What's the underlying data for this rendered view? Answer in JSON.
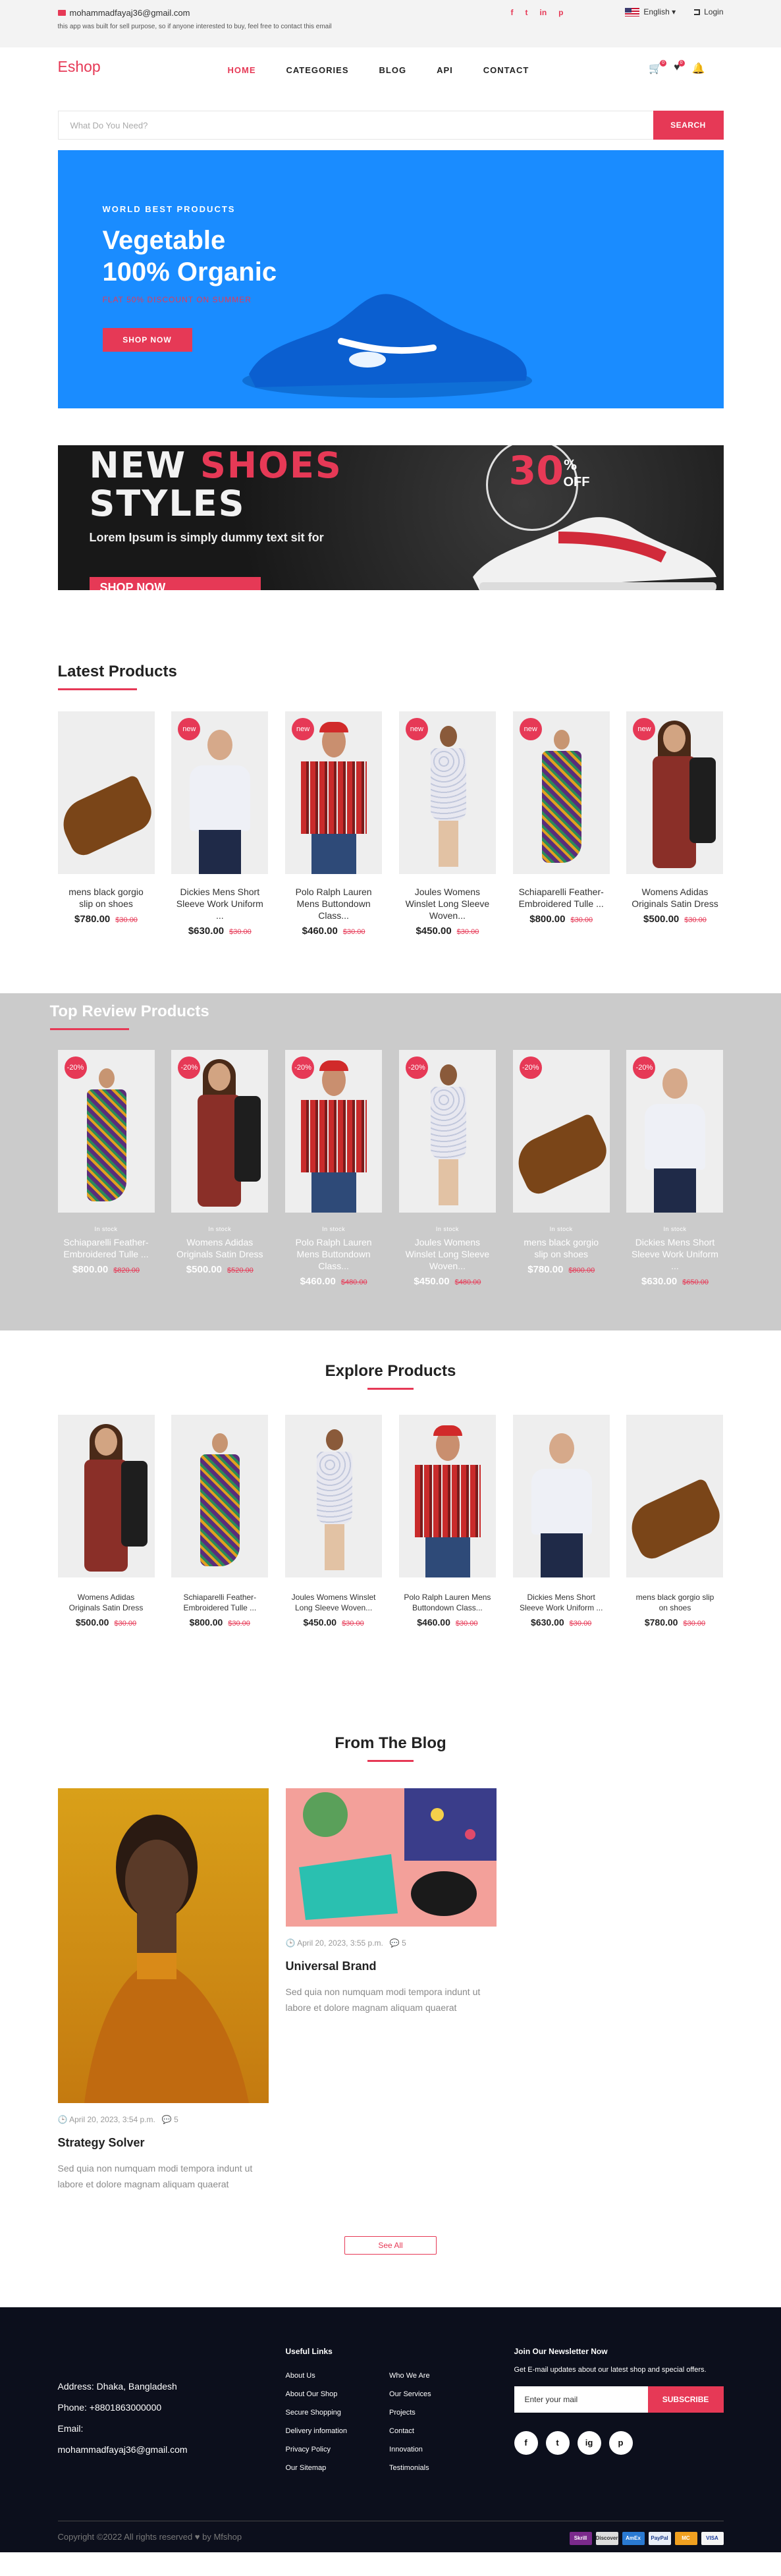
{
  "topbar": {
    "email": "mohammadfayaj36@gmail.com",
    "note": "this app was built for sell purpose, so if anyone interested to buy, feel free to contact this email",
    "social": [
      "f",
      "t",
      "in",
      "p"
    ],
    "language": "English",
    "login": "Login"
  },
  "header": {
    "logo": "Eshop",
    "nav": [
      "HOME",
      "CATEGORIES",
      "BLOG",
      "API",
      "CONTACT"
    ],
    "cart_count": "0",
    "wish_count": "0"
  },
  "search": {
    "placeholder": "What Do You Need?",
    "button": "SEARCH"
  },
  "hero": {
    "overline": "WORLD BEST PRODUCTS",
    "title_line1": "Vegetable",
    "title_line2": "100% Organic",
    "subtitle": "FLAT 50% DISCOUNT ON SUMMER",
    "button": "SHOP NOW"
  },
  "banner": {
    "line1_a": "NEW",
    "line1_b": "SHOES",
    "line2": "STYLES",
    "percent": "30",
    "percent_sign": "%",
    "off": "OFF",
    "text": "Lorem Ipsum is simply dummy text sit for",
    "button": "SHOP NOW"
  },
  "latest": {
    "title": "Latest Products",
    "products": [
      {
        "name": "mens black gorgio slip on shoes",
        "price": "$780.00",
        "old": "$30.00",
        "badge": "",
        "art": "shoe"
      },
      {
        "name": "Dickies Mens Short Sleeve Work Uniform ...",
        "price": "$630.00",
        "old": "$30.00",
        "badge": "new",
        "art": "man"
      },
      {
        "name": "Polo Ralph Lauren Mens Buttondown Class...",
        "price": "$460.00",
        "old": "$30.00",
        "badge": "new",
        "art": "polo"
      },
      {
        "name": "Joules Womens Winslet Long Sleeve Woven...",
        "price": "$450.00",
        "old": "$30.00",
        "badge": "new",
        "art": "dress"
      },
      {
        "name": "Schiaparelli Feather-Embroidered Tulle ...",
        "price": "$800.00",
        "old": "$30.00",
        "badge": "new",
        "art": "schia"
      },
      {
        "name": "Womens Adidas Originals Satin Dress",
        "price": "$500.00",
        "old": "$30.00",
        "badge": "new",
        "art": "womens"
      }
    ]
  },
  "top_review": {
    "title": "Top Review Products",
    "products": [
      {
        "name": "Schiaparelli Feather-Embroidered Tulle ...",
        "price": "$800.00",
        "old": "$820.00",
        "badge": "-20%",
        "stock": "In stock",
        "art": "schia"
      },
      {
        "name": "Womens Adidas Originals Satin Dress",
        "price": "$500.00",
        "old": "$520.00",
        "badge": "-20%",
        "stock": "In stock",
        "art": "womens"
      },
      {
        "name": "Polo Ralph Lauren Mens Buttondown Class...",
        "price": "$460.00",
        "old": "$480.00",
        "badge": "-20%",
        "stock": "In stock",
        "art": "polo"
      },
      {
        "name": "Joules Womens Winslet Long Sleeve Woven...",
        "price": "$450.00",
        "old": "$480.00",
        "badge": "-20%",
        "stock": "In stock",
        "art": "dress"
      },
      {
        "name": "mens black gorgio slip on shoes",
        "price": "$780.00",
        "old": "$800.00",
        "badge": "-20%",
        "stock": "In stock",
        "art": "shoe"
      },
      {
        "name": "Dickies Mens Short Sleeve Work Uniform ...",
        "price": "$630.00",
        "old": "$650.00",
        "badge": "-20%",
        "stock": "In stock",
        "art": "man"
      }
    ]
  },
  "explore": {
    "title": "Explore Products",
    "products": [
      {
        "name": "Womens Adidas Originals Satin Dress",
        "price": "$500.00",
        "old": "$30.00",
        "art": "womens"
      },
      {
        "name": "Schiaparelli Feather-Embroidered Tulle ...",
        "price": "$800.00",
        "old": "$30.00",
        "art": "schia"
      },
      {
        "name": "Joules Womens Winslet Long Sleeve Woven...",
        "price": "$450.00",
        "old": "$30.00",
        "art": "dress"
      },
      {
        "name": "Polo Ralph Lauren Mens Buttondown Class...",
        "price": "$460.00",
        "old": "$30.00",
        "art": "polo"
      },
      {
        "name": "Dickies Mens Short Sleeve Work Uniform ...",
        "price": "$630.00",
        "old": "$30.00",
        "art": "man"
      },
      {
        "name": "mens black gorgio slip on shoes",
        "price": "$780.00",
        "old": "$30.00",
        "art": "shoe"
      }
    ]
  },
  "blog": {
    "title": "From The Blog",
    "posts": [
      {
        "date": "April 20, 2023, 3:54 p.m.",
        "comments": "5",
        "title": "Strategy Solver",
        "excerpt": "Sed quia non numquam modi tempora indunt ut labore et dolore magnam aliquam quaerat"
      },
      {
        "date": "April 20, 2023, 3:55 p.m.",
        "comments": "5",
        "title": "Universal Brand",
        "excerpt": "Sed quia non numquam modi tempora indunt ut labore et dolore magnam aliquam quaerat"
      }
    ],
    "see_all": "See All"
  },
  "footer": {
    "address": "Address: Dhaka, Bangladesh",
    "phone": "Phone: +8801863000000",
    "email_label": "Email:",
    "email": "mohammadfayaj36@gmail.com",
    "links_title": "Useful Links",
    "links_col1": [
      "About Us",
      "About Our Shop",
      "Secure Shopping",
      "Delivery infomation",
      "Privacy Policy",
      "Our Sitemap"
    ],
    "links_col2": [
      "Who We Are",
      "Our Services",
      "Projects",
      "Contact",
      "Innovation",
      "Testimonials"
    ],
    "newsletter_title": "Join Our Newsletter Now",
    "newsletter_text": "Get E-mail updates about our latest shop and special offers.",
    "newsletter_placeholder": "Enter your mail",
    "subscribe": "SUBSCRIBE",
    "social": [
      "f",
      "t",
      "ig",
      "p"
    ],
    "copyright": "Copyright ©2022 All rights reserved ♥ by Mfshop",
    "payments": [
      "Skrill",
      "Discover",
      "AmEx",
      "PayPal",
      "MC",
      "VISA"
    ]
  },
  "colors": {
    "accent": "#e63956",
    "hero_bg": "#1a8cff",
    "review_bg": "#cbcbcb",
    "footer_bg": "#0c0f1c"
  }
}
